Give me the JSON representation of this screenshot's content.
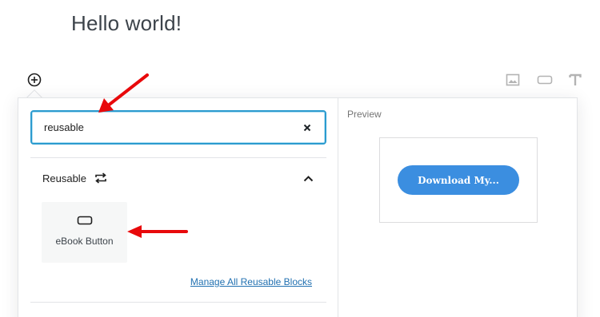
{
  "editor": {
    "title": "Hello world!"
  },
  "toolbar": {
    "inserter_icon": "plus-circle-icon",
    "side_icons": [
      "image-icon",
      "button-icon",
      "text-icon"
    ]
  },
  "inserter": {
    "search": {
      "value": "reusable",
      "clear_icon": "close-icon"
    },
    "panel": {
      "title": "Reusable",
      "title_icon": "reusable-icon",
      "toggle_icon": "chevron-up-icon",
      "items": [
        {
          "label": "eBook Button",
          "icon": "button-icon"
        }
      ],
      "manage_link": "Manage All Reusable Blocks"
    },
    "preview": {
      "label": "Preview",
      "button_text": "Download My..."
    }
  },
  "annotations": {
    "arrow_color": "#e8090b"
  },
  "colors": {
    "accent": "#2b9bcf",
    "link": "#2271b1",
    "preview_button": "#3b8ee0"
  }
}
